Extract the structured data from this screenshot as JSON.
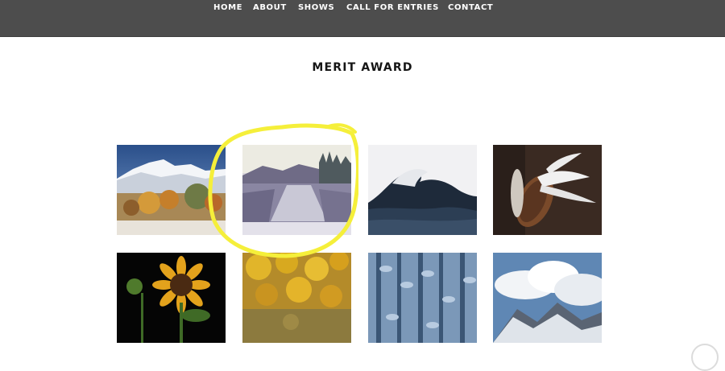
{
  "nav": {
    "items": [
      {
        "label": "HOME"
      },
      {
        "label": "ABOUT"
      },
      {
        "label": "SHOWS"
      },
      {
        "label": "CALL FOR ENTRIES"
      },
      {
        "label": "CONTACT"
      }
    ]
  },
  "page": {
    "title": "MERIT AWARD"
  },
  "colors": {
    "nav_background": "#4d4d4d",
    "nav_text": "#ffffff",
    "highlight_marker": "#f5ef3a"
  },
  "gallery": {
    "thumbnails": [
      {
        "subject": "snowy mountain with autumn trees"
      },
      {
        "subject": "painted river landscape"
      },
      {
        "subject": "crashing ocean wave"
      },
      {
        "subject": "milkweed pod with seeds"
      },
      {
        "subject": "sunflowers on black"
      },
      {
        "subject": "yellow flowers"
      },
      {
        "subject": "frosted plants in blue"
      },
      {
        "subject": "clouds over snowy peak"
      }
    ]
  }
}
